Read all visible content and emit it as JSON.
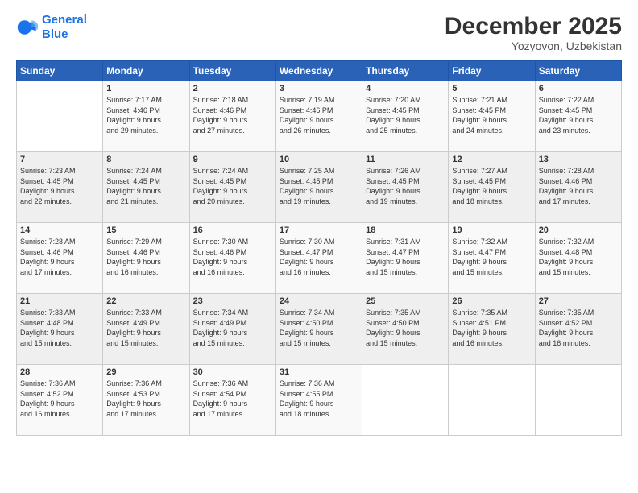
{
  "header": {
    "logo_line1": "General",
    "logo_line2": "Blue",
    "title": "December 2025",
    "subtitle": "Yozyovon, Uzbekistan"
  },
  "columns": [
    "Sunday",
    "Monday",
    "Tuesday",
    "Wednesday",
    "Thursday",
    "Friday",
    "Saturday"
  ],
  "weeks": [
    [
      {
        "day": "",
        "info": ""
      },
      {
        "day": "1",
        "info": "Sunrise: 7:17 AM\nSunset: 4:46 PM\nDaylight: 9 hours\nand 29 minutes."
      },
      {
        "day": "2",
        "info": "Sunrise: 7:18 AM\nSunset: 4:46 PM\nDaylight: 9 hours\nand 27 minutes."
      },
      {
        "day": "3",
        "info": "Sunrise: 7:19 AM\nSunset: 4:46 PM\nDaylight: 9 hours\nand 26 minutes."
      },
      {
        "day": "4",
        "info": "Sunrise: 7:20 AM\nSunset: 4:45 PM\nDaylight: 9 hours\nand 25 minutes."
      },
      {
        "day": "5",
        "info": "Sunrise: 7:21 AM\nSunset: 4:45 PM\nDaylight: 9 hours\nand 24 minutes."
      },
      {
        "day": "6",
        "info": "Sunrise: 7:22 AM\nSunset: 4:45 PM\nDaylight: 9 hours\nand 23 minutes."
      }
    ],
    [
      {
        "day": "7",
        "info": "Sunrise: 7:23 AM\nSunset: 4:45 PM\nDaylight: 9 hours\nand 22 minutes."
      },
      {
        "day": "8",
        "info": "Sunrise: 7:24 AM\nSunset: 4:45 PM\nDaylight: 9 hours\nand 21 minutes."
      },
      {
        "day": "9",
        "info": "Sunrise: 7:24 AM\nSunset: 4:45 PM\nDaylight: 9 hours\nand 20 minutes."
      },
      {
        "day": "10",
        "info": "Sunrise: 7:25 AM\nSunset: 4:45 PM\nDaylight: 9 hours\nand 19 minutes."
      },
      {
        "day": "11",
        "info": "Sunrise: 7:26 AM\nSunset: 4:45 PM\nDaylight: 9 hours\nand 19 minutes."
      },
      {
        "day": "12",
        "info": "Sunrise: 7:27 AM\nSunset: 4:45 PM\nDaylight: 9 hours\nand 18 minutes."
      },
      {
        "day": "13",
        "info": "Sunrise: 7:28 AM\nSunset: 4:46 PM\nDaylight: 9 hours\nand 17 minutes."
      }
    ],
    [
      {
        "day": "14",
        "info": "Sunrise: 7:28 AM\nSunset: 4:46 PM\nDaylight: 9 hours\nand 17 minutes."
      },
      {
        "day": "15",
        "info": "Sunrise: 7:29 AM\nSunset: 4:46 PM\nDaylight: 9 hours\nand 16 minutes."
      },
      {
        "day": "16",
        "info": "Sunrise: 7:30 AM\nSunset: 4:46 PM\nDaylight: 9 hours\nand 16 minutes."
      },
      {
        "day": "17",
        "info": "Sunrise: 7:30 AM\nSunset: 4:47 PM\nDaylight: 9 hours\nand 16 minutes."
      },
      {
        "day": "18",
        "info": "Sunrise: 7:31 AM\nSunset: 4:47 PM\nDaylight: 9 hours\nand 15 minutes."
      },
      {
        "day": "19",
        "info": "Sunrise: 7:32 AM\nSunset: 4:47 PM\nDaylight: 9 hours\nand 15 minutes."
      },
      {
        "day": "20",
        "info": "Sunrise: 7:32 AM\nSunset: 4:48 PM\nDaylight: 9 hours\nand 15 minutes."
      }
    ],
    [
      {
        "day": "21",
        "info": "Sunrise: 7:33 AM\nSunset: 4:48 PM\nDaylight: 9 hours\nand 15 minutes."
      },
      {
        "day": "22",
        "info": "Sunrise: 7:33 AM\nSunset: 4:49 PM\nDaylight: 9 hours\nand 15 minutes."
      },
      {
        "day": "23",
        "info": "Sunrise: 7:34 AM\nSunset: 4:49 PM\nDaylight: 9 hours\nand 15 minutes."
      },
      {
        "day": "24",
        "info": "Sunrise: 7:34 AM\nSunset: 4:50 PM\nDaylight: 9 hours\nand 15 minutes."
      },
      {
        "day": "25",
        "info": "Sunrise: 7:35 AM\nSunset: 4:50 PM\nDaylight: 9 hours\nand 15 minutes."
      },
      {
        "day": "26",
        "info": "Sunrise: 7:35 AM\nSunset: 4:51 PM\nDaylight: 9 hours\nand 16 minutes."
      },
      {
        "day": "27",
        "info": "Sunrise: 7:35 AM\nSunset: 4:52 PM\nDaylight: 9 hours\nand 16 minutes."
      }
    ],
    [
      {
        "day": "28",
        "info": "Sunrise: 7:36 AM\nSunset: 4:52 PM\nDaylight: 9 hours\nand 16 minutes."
      },
      {
        "day": "29",
        "info": "Sunrise: 7:36 AM\nSunset: 4:53 PM\nDaylight: 9 hours\nand 17 minutes."
      },
      {
        "day": "30",
        "info": "Sunrise: 7:36 AM\nSunset: 4:54 PM\nDaylight: 9 hours\nand 17 minutes."
      },
      {
        "day": "31",
        "info": "Sunrise: 7:36 AM\nSunset: 4:55 PM\nDaylight: 9 hours\nand 18 minutes."
      },
      {
        "day": "",
        "info": ""
      },
      {
        "day": "",
        "info": ""
      },
      {
        "day": "",
        "info": ""
      }
    ]
  ]
}
